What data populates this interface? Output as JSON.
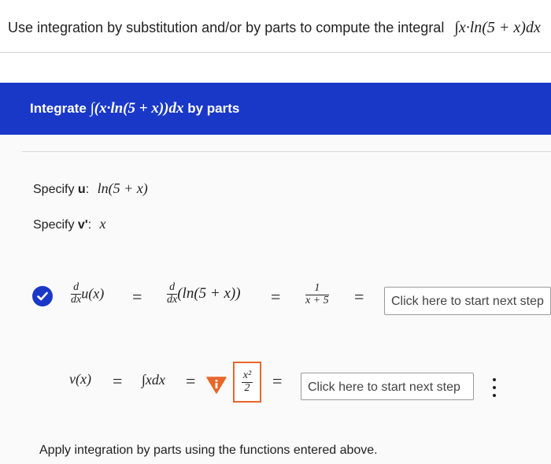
{
  "question": {
    "text": "Use integration by substitution and/or by parts to compute the integral",
    "integral": "∫x·ln(5 + x)dx"
  },
  "banner": {
    "prefix": "Integrate",
    "integral": "∫(x·ln(5 + x))dx",
    "suffix": "by parts"
  },
  "spec_u": {
    "label": "Specify",
    "var": "u",
    "colon": ":",
    "value": "ln(5 + x)"
  },
  "spec_v": {
    "label": "Specify",
    "var": "v'",
    "colon": ":",
    "value": "x"
  },
  "row1": {
    "d": "d",
    "dx": "dx",
    "lhs_fn": "u(x)",
    "mid_fn": "(ln(5 + x))",
    "res_num": "1",
    "res_den": "x + 5",
    "step_button": "Click here to start next step"
  },
  "row2": {
    "lhs": "v(x)",
    "integral": "∫xdx",
    "answer_num": "x²",
    "answer_den": "2",
    "warning_icon": "warning-triangle",
    "step_button": "Click here to start next step"
  },
  "colors": {
    "banner": "#1a38c8",
    "check": "#1a38c8",
    "warning": "#e8662a"
  },
  "footer": {
    "apply_text": "Apply integration by parts using the functions entered above."
  }
}
